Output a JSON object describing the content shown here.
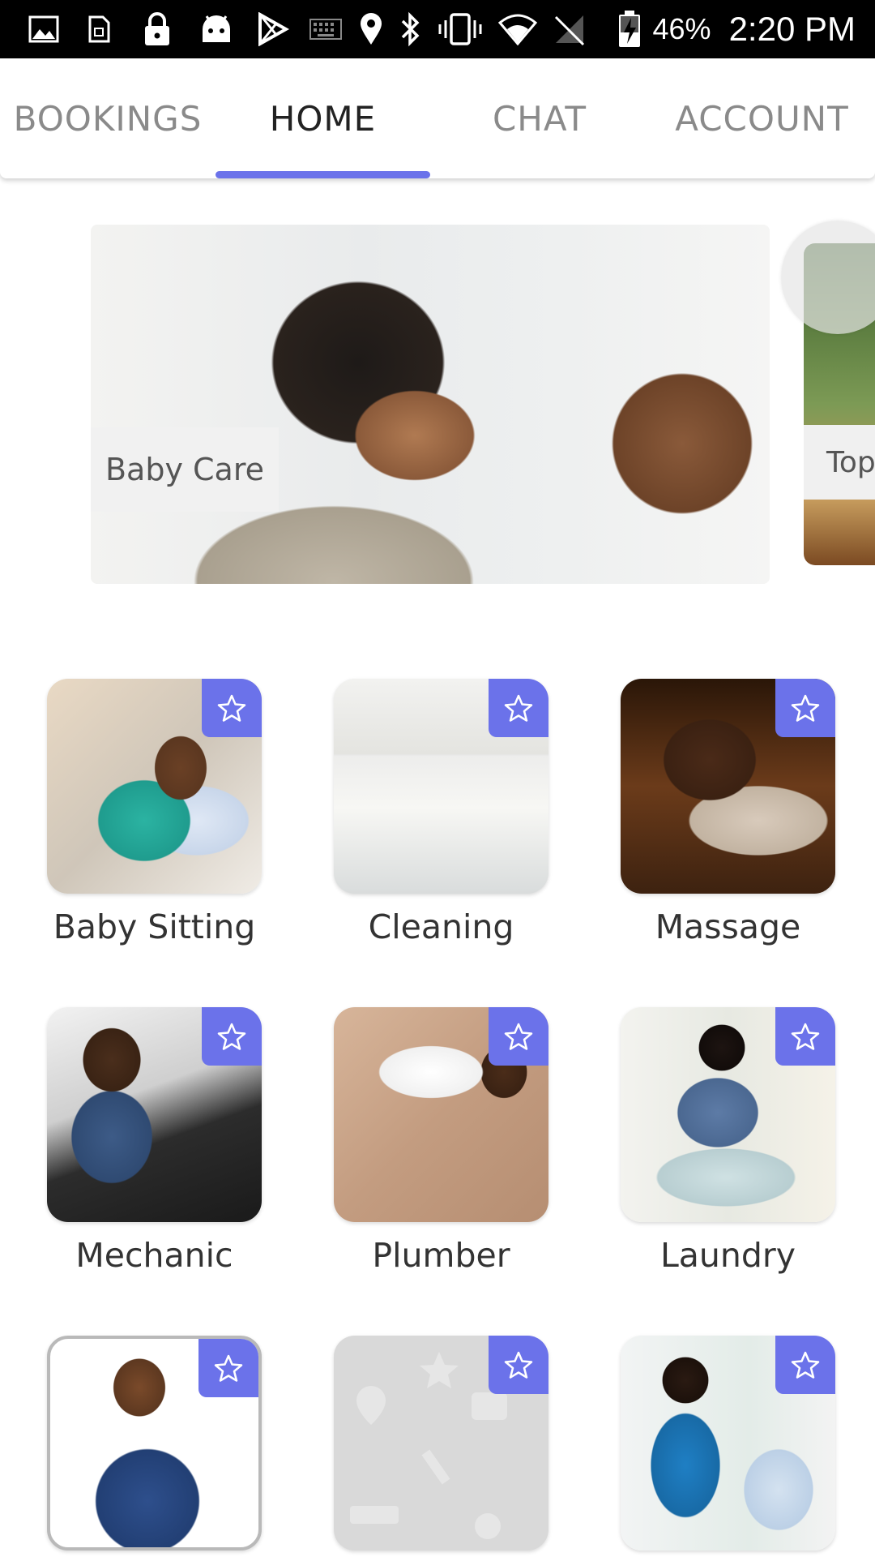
{
  "status_bar": {
    "battery_percent": "46%",
    "time": "2:20 PM",
    "icons": [
      "gallery-icon",
      "sim-icon",
      "lock-icon",
      "android-icon",
      "play-store-icon",
      "keyboard-icon",
      "location-icon",
      "bluetooth-icon",
      "vibrate-icon",
      "wifi-icon",
      "no-signal-icon",
      "battery-charging-icon"
    ]
  },
  "tabs": [
    {
      "label": "BOOKINGS",
      "active": false
    },
    {
      "label": "HOME",
      "active": true
    },
    {
      "label": "CHAT",
      "active": false
    },
    {
      "label": "ACCOUNT",
      "active": false
    }
  ],
  "accent_color": "#6b72ea",
  "carousel": {
    "slides": [
      {
        "label": "Baby Care"
      },
      {
        "label": "Top"
      }
    ]
  },
  "services": [
    {
      "label": "Baby Sitting",
      "icon": "star-icon"
    },
    {
      "label": "Cleaning",
      "icon": "star-icon"
    },
    {
      "label": "Massage",
      "icon": "star-icon"
    },
    {
      "label": "Mechanic",
      "icon": "star-icon"
    },
    {
      "label": "Plumber",
      "icon": "star-icon"
    },
    {
      "label": "Laundry",
      "icon": "star-icon"
    },
    {
      "label": "",
      "icon": "star-icon"
    },
    {
      "label": "",
      "icon": "star-icon"
    },
    {
      "label": "",
      "icon": "star-icon"
    }
  ]
}
